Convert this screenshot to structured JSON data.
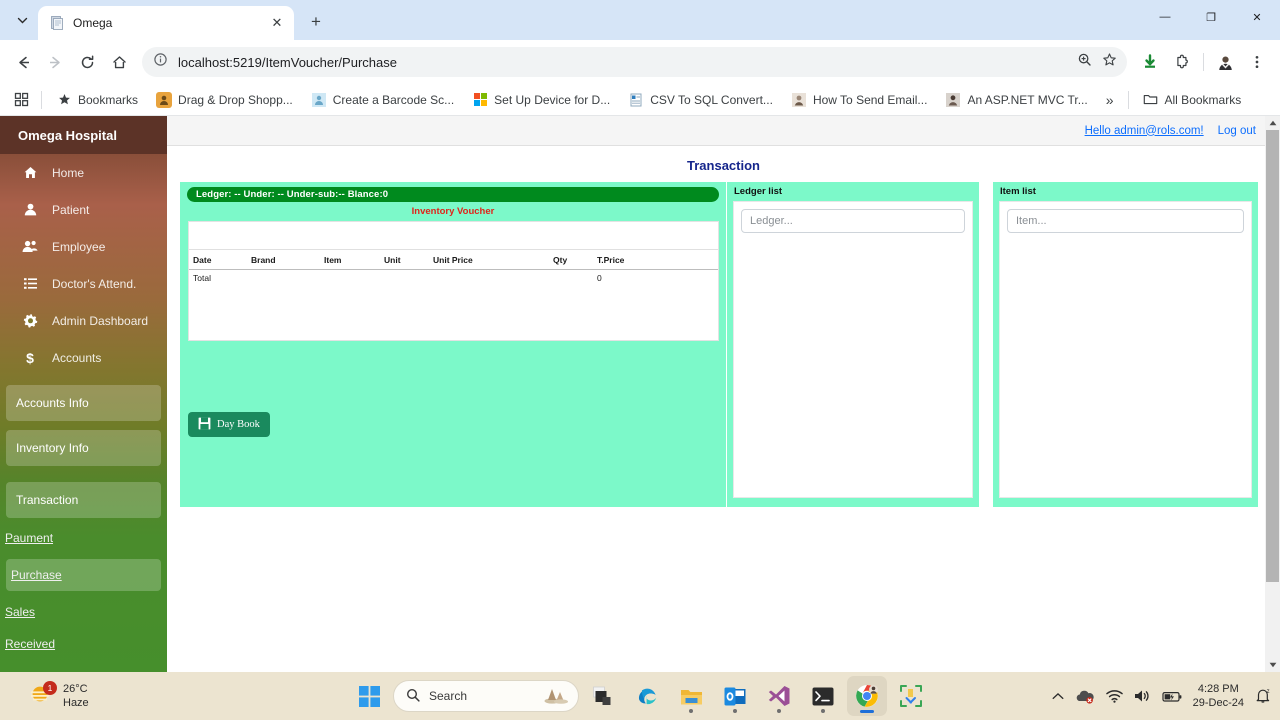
{
  "browser": {
    "tab": {
      "title": "Omega",
      "favicon": "document-icon",
      "close": "✕"
    },
    "new_tab": "+",
    "window_controls": {
      "minimize": "—",
      "maximize": "❐",
      "close": "✕"
    },
    "nav": {
      "back": "←",
      "forward": "→",
      "reload": "⟳",
      "home": "⌂"
    },
    "omnibox": {
      "info_icon": "info-circle-icon",
      "url": "localhost:5219/ItemVoucher/Purchase",
      "zoom_icon": "search-plus-icon",
      "bookmark_icon": "star-icon"
    },
    "toolbar_right": {
      "download_icon": "download-icon",
      "extensions_icon": "puzzle-icon",
      "profile_icon": "avatar-icon",
      "menu_icon": "kebab-menu-icon"
    },
    "bookmarks": [
      {
        "label": "Bookmarks",
        "icon": "star"
      },
      {
        "label": "Drag & Drop Shopp...",
        "icon": "orange"
      },
      {
        "label": "Create a Barcode Sc...",
        "icon": "lightblue"
      },
      {
        "label": "Set Up Device for D...",
        "icon": "microsoft"
      },
      {
        "label": "CSV To SQL Convert...",
        "icon": "page"
      },
      {
        "label": "How To Send Email...",
        "icon": "person"
      },
      {
        "label": "An ASP.NET MVC Tr...",
        "icon": "person2"
      }
    ],
    "bookmarks_overflow": "»",
    "all_bookmarks": {
      "label": "All Bookmarks",
      "icon": "folder-icon"
    },
    "apps_grid_icon": "apps-grid-icon"
  },
  "app": {
    "brand": "Omega Hospital",
    "header": {
      "greeting": "Hello admin@rols.com!",
      "logout": "Log out"
    },
    "page_title": "Transaction",
    "sidebar": {
      "items": [
        {
          "label": "Home",
          "icon": "home-icon"
        },
        {
          "label": "Patient",
          "icon": "user-icon"
        },
        {
          "label": "Employee",
          "icon": "users-icon"
        },
        {
          "label": "Doctor's Attend.",
          "icon": "list-icon"
        },
        {
          "label": "Admin Dashboard",
          "icon": "gear-icon"
        },
        {
          "label": "Accounts",
          "icon": "dollar-icon"
        }
      ],
      "sections": [
        {
          "label": "Accounts Info"
        },
        {
          "label": "Inventory Info"
        },
        {
          "label": "Transaction"
        }
      ],
      "links": [
        {
          "label": "Paument",
          "active": false
        },
        {
          "label": "Purchase",
          "active": true
        },
        {
          "label": "Sales",
          "active": false
        },
        {
          "label": "Received",
          "active": false
        }
      ]
    },
    "voucher": {
      "ledger_bar": "Ledger: -- Under: -- Under-sub:-- Blance:0",
      "subtitle": "Inventory Voucher",
      "columns": [
        "Date",
        "Brand",
        "Item",
        "Unit",
        "Unit Price",
        "Qty",
        "T.Price"
      ],
      "rows": [],
      "total_label": "Total",
      "total_value": "0",
      "day_book_button": "Day Book",
      "day_book_icon": "save-icon"
    },
    "ledger_list": {
      "title": "Ledger list",
      "search_placeholder": "Ledger...",
      "search_value": "",
      "items": []
    },
    "item_list": {
      "title": "Item list",
      "search_placeholder": "Item...",
      "search_value": "",
      "items": []
    },
    "colors": {
      "panel_mint": "#7CF9C9",
      "ledger_green": "#008a1e",
      "subtitle_red": "#e0241b",
      "title_blue": "#16268c",
      "daybook_green": "#1a8a5e"
    }
  },
  "taskbar": {
    "weather": {
      "temp": "26°C",
      "condition": "Haze",
      "badge": "1",
      "icon": "haze-icon"
    },
    "start_icon": "windows-start-icon",
    "search": {
      "label": "Search",
      "icon": "search-icon"
    },
    "apps": [
      {
        "name": "task-view-icon",
        "running": false
      },
      {
        "name": "edge-icon",
        "running": true
      },
      {
        "name": "file-explorer-icon",
        "running": true
      },
      {
        "name": "outlook-icon",
        "running": true
      },
      {
        "name": "visual-studio-icon",
        "running": true
      },
      {
        "name": "terminal-icon",
        "running": true
      },
      {
        "name": "chrome-icon",
        "running": true,
        "active": true
      },
      {
        "name": "snipping-tool-icon",
        "running": false
      }
    ],
    "tray": {
      "chevron": "⌃",
      "onedrive": "onedrive-error-icon",
      "wifi": "wifi-icon",
      "volume": "speaker-icon",
      "battery": "battery-icon",
      "time": "4:28 PM",
      "date": "29-Dec-24",
      "notifications": "bell-dnd-icon"
    }
  }
}
